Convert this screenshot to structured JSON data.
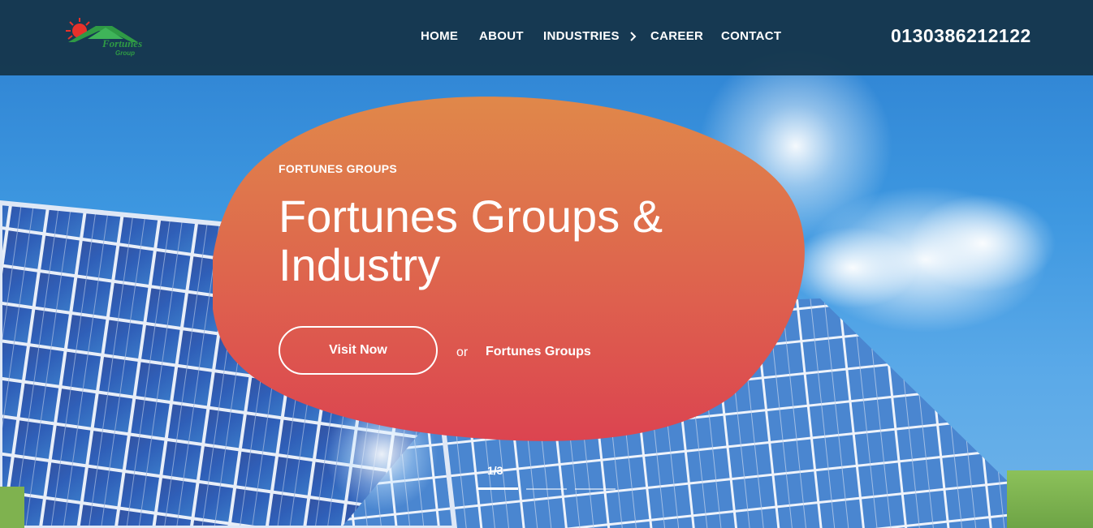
{
  "nav": {
    "home": "HOME",
    "about": "ABOUT",
    "industries": "INDUSTRIES",
    "career": "CAREER",
    "contact": "CONTACT",
    "phone": "0130386212122"
  },
  "logo": {
    "text_main": "Fortunes",
    "text_sub": "Group"
  },
  "hero": {
    "eyebrow": "FORTUNES GROUPS",
    "headline": "Fortunes Groups & Industry",
    "primary_button": "Visit Now",
    "or_text": "or",
    "secondary_link": "Fortunes Groups"
  },
  "slider": {
    "counter": "1/3",
    "current": 1,
    "total": 3
  },
  "colors": {
    "navbar_bg": "#143448",
    "blob_top": "#e0884a",
    "blob_bottom": "#dc4750",
    "sky": "#3d97e0",
    "panel": "#2b4fa8"
  },
  "icons": {
    "industries_dropdown": "chevron-right-icon",
    "logo_sun": "sun-icon"
  }
}
